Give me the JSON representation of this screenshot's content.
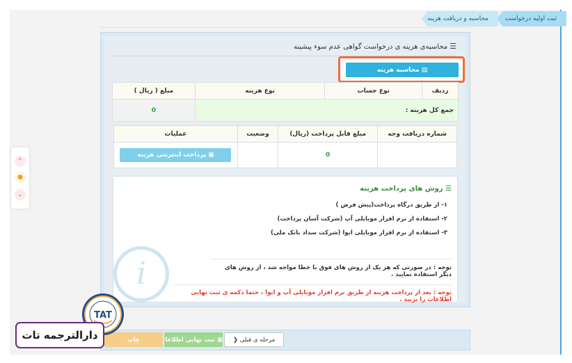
{
  "breadcrumb": {
    "items": [
      "ثبت اولیه درخواست",
      "محاسبه و دریافت هزینه"
    ]
  },
  "panel": {
    "title": "محاسبه‌ی هزینه ی درخواست گواهی عدم سوء پیشینه",
    "title_icon": "list-icon",
    "calc_button": "محاسبه هزینه",
    "calc_icon": "calculator-icon"
  },
  "cost_table": {
    "headers": [
      "ردیف",
      "نوع حساب",
      "نوع هزینه",
      "مبلغ ( ریال )"
    ],
    "total_label": "جمع کل هزینه :",
    "total_value": "0"
  },
  "payment_table": {
    "headers": [
      "شماره دریافت وجه",
      "مبلغ قابل پرداخت (ریال)",
      "وضعیت",
      "عملیات"
    ],
    "row": {
      "receipt_no": "",
      "amount": "0",
      "status": "",
      "action": "پرداخت اینترنتی هزینه"
    }
  },
  "methods": {
    "title": "روش های پرداخت هزینه",
    "items": [
      "۱- از طریق درگاه پرداخت(پیش فرض )",
      "۲- استفاده از نرم افزار موبایلی آپ (شرکت آسان پرداخت)",
      "۳- استفاده از نرم افزار موبایلی ایوا (شرکت سداد بانک ملی)"
    ],
    "note": "توجه : در صورتی که هر یک از روش های فوق با خطا مواجه شد ، از روش های دیگر استفاده نمایید .",
    "warning": "توجه : بعد از پرداخت هزینه از طریق نرم افزار موبایلی آپ و ایوا ، حتما دکمه ی ثبت نهایی اطلاعات را بزنید ."
  },
  "footer": {
    "prev_label": "مرحله ی قبلی",
    "submit_label": "ثبت نهایی اطلاعات",
    "print_label": "چاپ"
  },
  "side_widget": {
    "icons": [
      "double-chevron-up-icon",
      "flame-icon",
      "double-chevron-down-icon"
    ]
  },
  "brand": {
    "name": "دارالترجمه تات",
    "seal_text": "TAT"
  },
  "colors": {
    "accent": "#2fb2dc",
    "highlight_border": "#ef6a3a",
    "success_green": "#2f9d3e",
    "warning_red": "#e43d2f",
    "submit_green": "#9fd690",
    "print_orange": "#f7ce88"
  }
}
